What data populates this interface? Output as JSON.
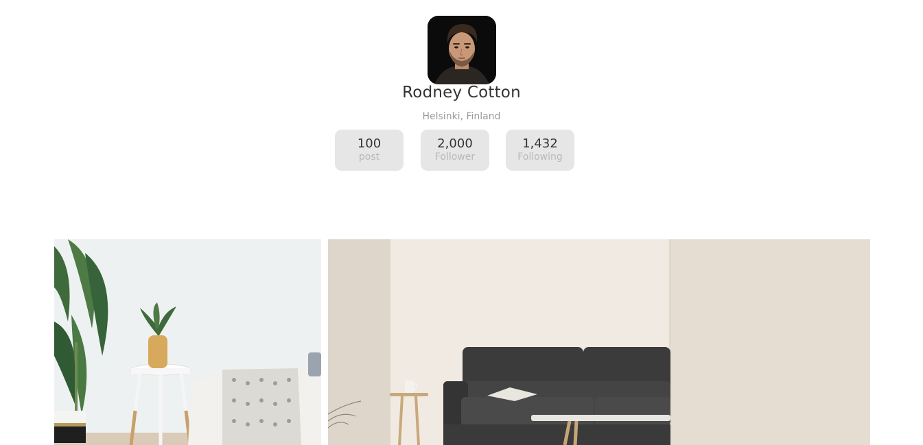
{
  "profile": {
    "name": "Rodney Cotton",
    "location": "Helsinki, Finland"
  },
  "stats": [
    {
      "value": "100",
      "label": "post"
    },
    {
      "value": "2,000",
      "label": "Follower"
    },
    {
      "value": "1,432",
      "label": "Following"
    }
  ],
  "gallery": {
    "photos": [
      {
        "subject": "living-room-plant-side-table"
      },
      {
        "subject": "living-room-dark-sofa"
      }
    ]
  },
  "colors": {
    "text": "#333333",
    "muted": "#9a9a9a",
    "stat_bg": "#e6e6e6"
  }
}
